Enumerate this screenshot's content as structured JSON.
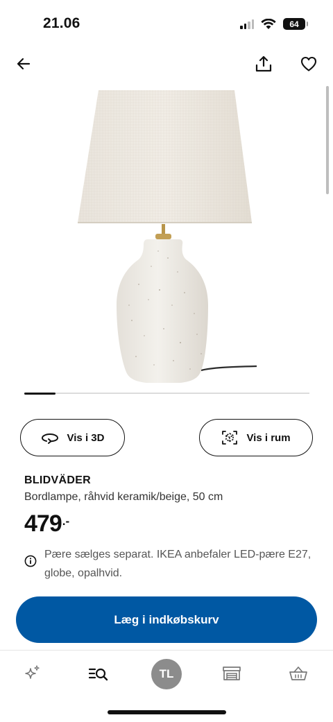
{
  "status_bar": {
    "time": "21.06",
    "battery": "64"
  },
  "product": {
    "name": "BLIDVÄDER",
    "description": "Bordlampe, råhvid keramik/beige, 50 cm",
    "price": "479",
    "price_suffix": ".-",
    "notice": "Pære sælges separat. IKEA anbefaler LED-pære E27, globe, opalhvid.",
    "image_alt": "BLIDVÄDER bordlampe",
    "carousel_progress": 0.11
  },
  "actions": {
    "view_3d_label": "Vis i 3D",
    "view_room_label": "Vis i rum",
    "add_to_cart_label": "Læg i indkøbskurv"
  },
  "bottom_nav": {
    "avatar_initials": "TL",
    "items": [
      "sparkle-icon",
      "search-list-icon",
      "avatar",
      "store-icon",
      "basket-icon"
    ]
  },
  "colors": {
    "brand_blue": "#0058a3",
    "avatar_gray": "#8c8c8c"
  }
}
